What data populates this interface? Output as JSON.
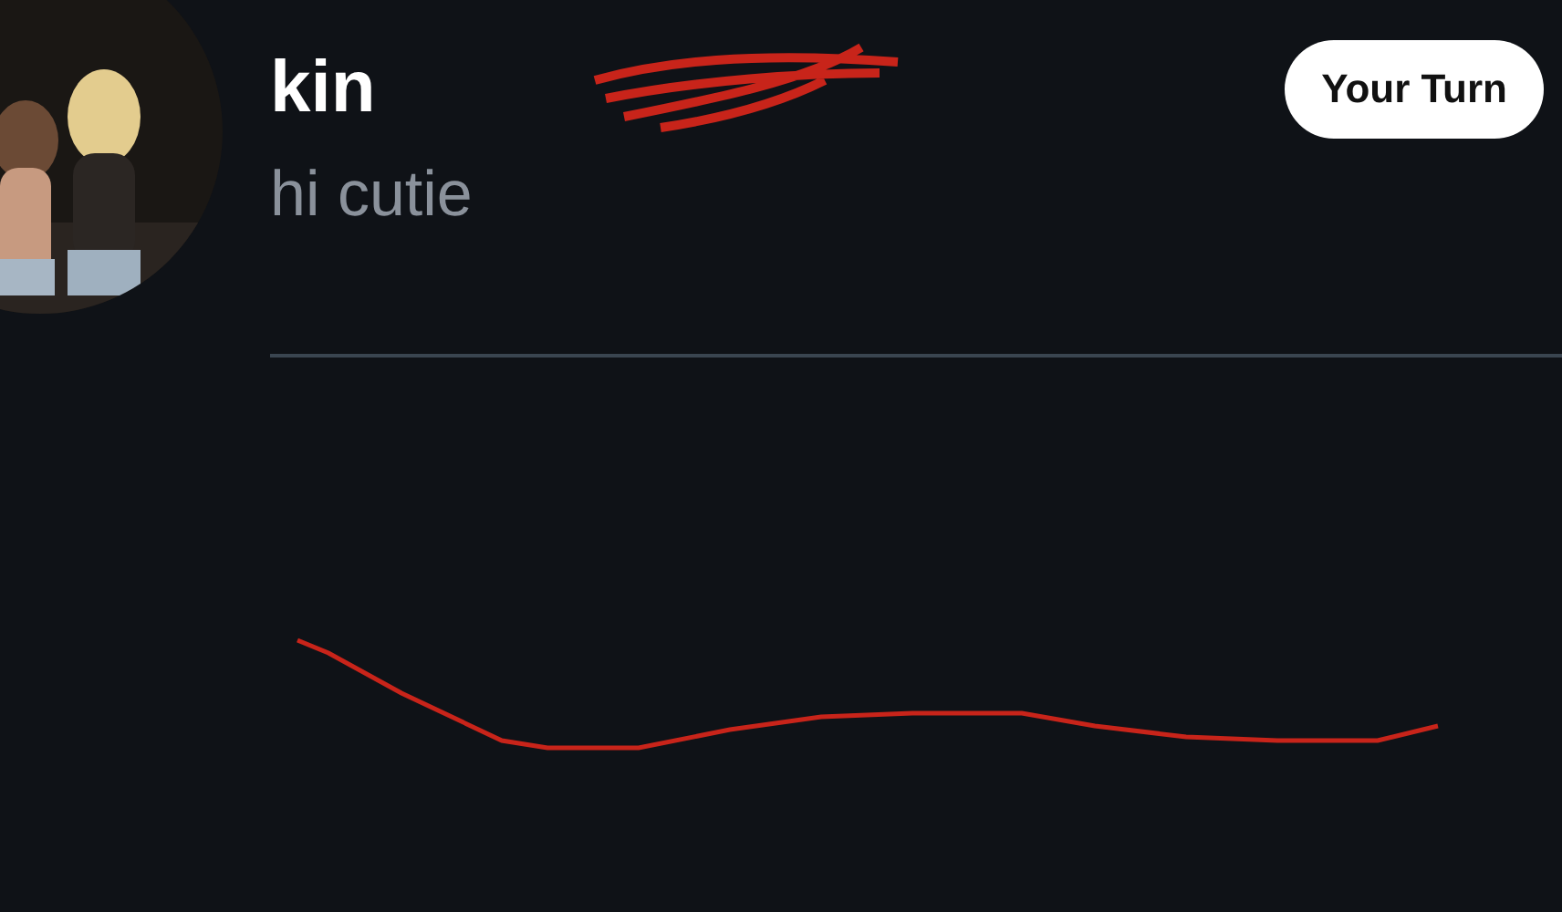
{
  "conversation": {
    "name": "kin",
    "message": "hi cutie",
    "status_button": "Your Turn"
  }
}
